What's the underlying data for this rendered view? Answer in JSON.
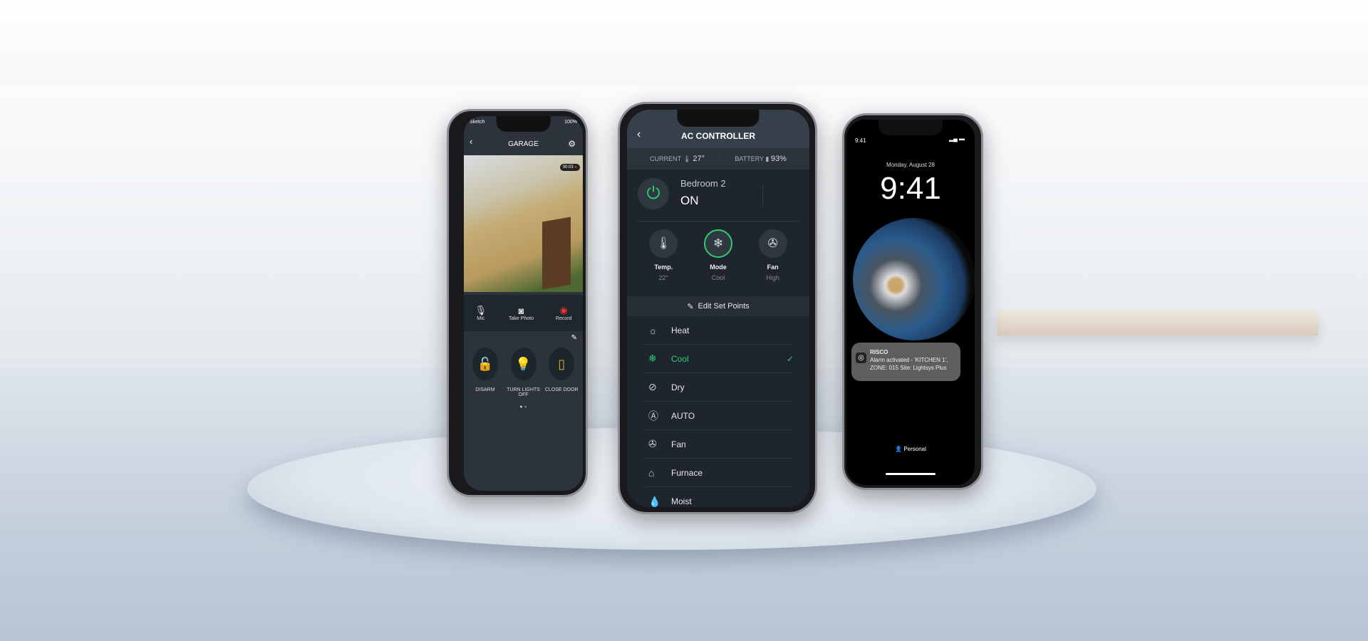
{
  "left_phone": {
    "status_carrier": "Sketch",
    "status_battery": "100%",
    "title": "GARAGE",
    "rec_timer": "00:03",
    "controls": [
      {
        "icon": "mic-muted-icon",
        "label": "Mic"
      },
      {
        "icon": "camera-icon",
        "label": "Take Photo"
      },
      {
        "icon": "record-icon",
        "label": "Record"
      }
    ],
    "actions": [
      {
        "icon": "unlock-icon",
        "label": "DISARM",
        "color": "#2ecc71"
      },
      {
        "icon": "lightbulb-icon",
        "label": "TURN LIGHTS OFF",
        "color": "#d4b21c"
      },
      {
        "icon": "door-icon",
        "label": "CLOSE DOOR",
        "color": "#d4b21c"
      }
    ],
    "page_indicator": "1 of 2"
  },
  "center_phone": {
    "title": "AC CONTROLLER",
    "current_label": "CURRENT",
    "current_value": "27°",
    "battery_label": "BATTERY",
    "battery_value": "93%",
    "device_name": "Bedroom 2",
    "device_state": "ON",
    "accent": "#2ecc71",
    "settings": [
      {
        "icon": "thermometer-icon",
        "label": "Temp.",
        "value": "22°"
      },
      {
        "icon": "mode-icon",
        "label": "Mode",
        "value": "Cool"
      },
      {
        "icon": "fan-icon",
        "label": "Fan",
        "value": "High"
      }
    ],
    "edit_label": "Edit Set Points",
    "modes": [
      {
        "icon": "sun-icon",
        "label": "Heat"
      },
      {
        "icon": "snowflake-icon",
        "label": "Cool",
        "selected": true
      },
      {
        "icon": "drop-slash-icon",
        "label": "Dry"
      },
      {
        "icon": "auto-icon",
        "label": "AUTO"
      },
      {
        "icon": "fan-icon",
        "label": "Fan"
      },
      {
        "icon": "furnace-icon",
        "label": "Furnace"
      },
      {
        "icon": "drop-icon",
        "label": "Moist"
      }
    ]
  },
  "right_phone": {
    "status_time": "9:41",
    "date": "Monday, August 28",
    "time": "9:41",
    "notification": {
      "app": "RISCO",
      "message": "Alarm activated - 'KITCHEN 1', ZONE: 015 Site: Lightsys Plus"
    },
    "focus": "Personal"
  }
}
